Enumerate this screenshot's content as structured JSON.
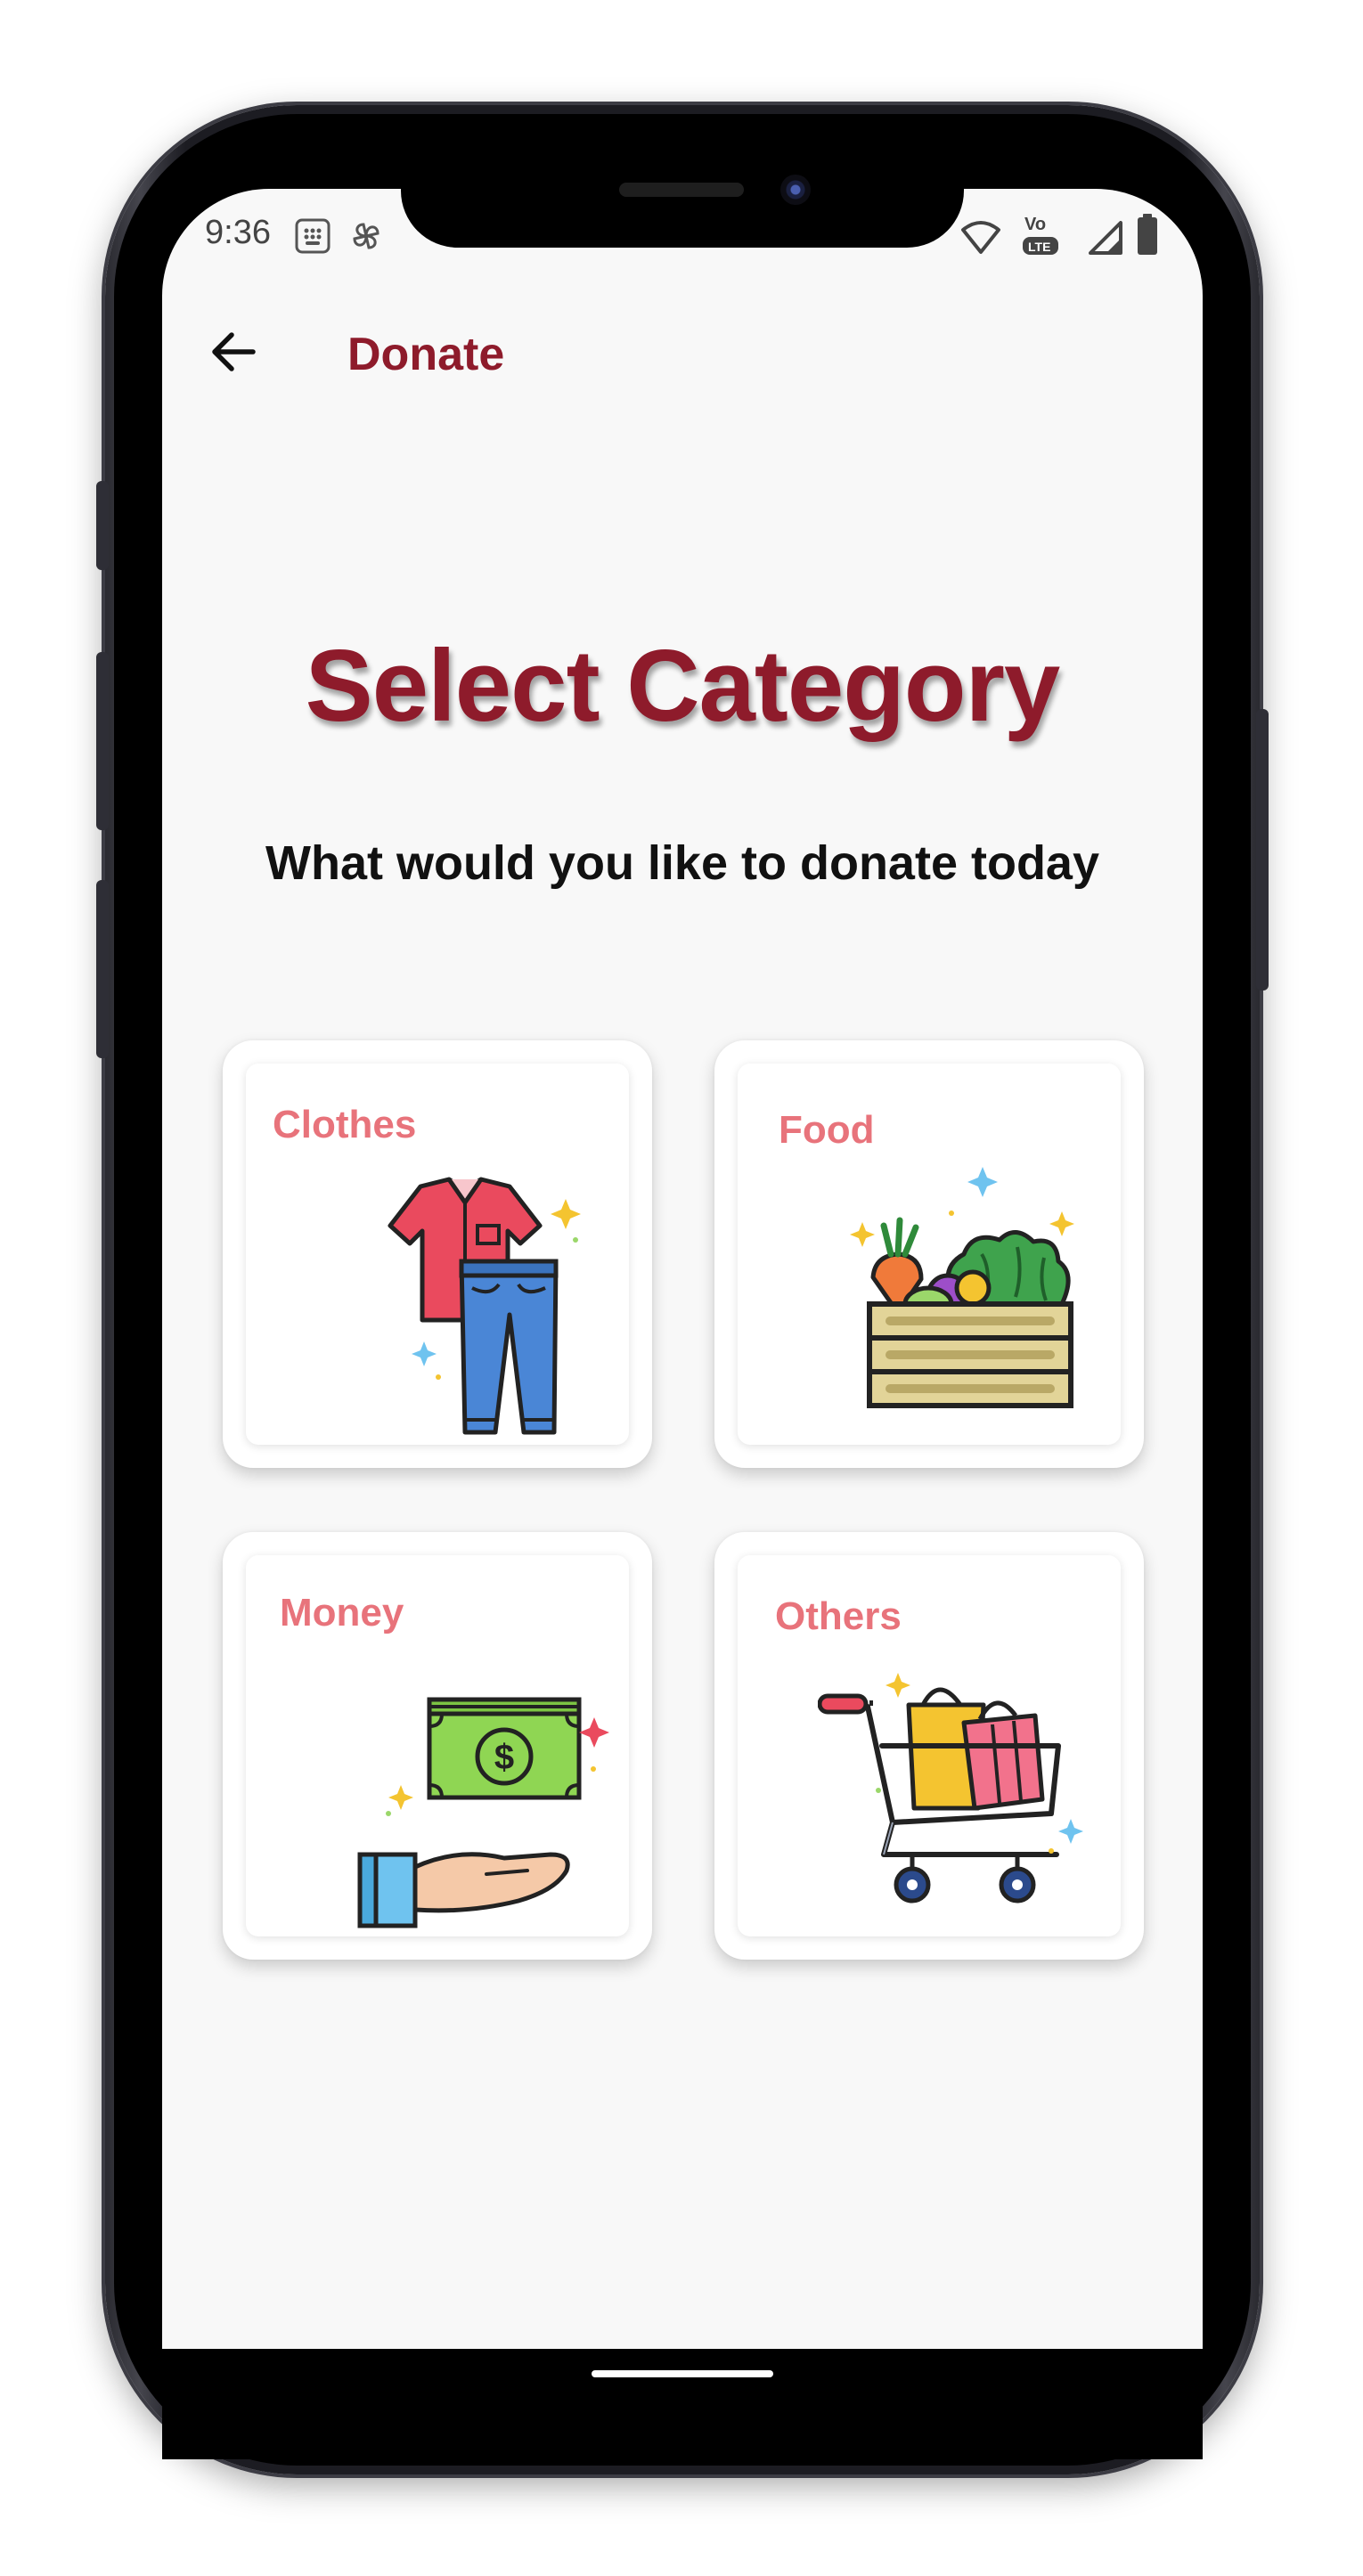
{
  "status_bar": {
    "time": "9:36"
  },
  "app_bar": {
    "title": "Donate",
    "back_icon": "arrow-left-icon"
  },
  "main": {
    "title": "Select Category",
    "subtitle": "What would you like to donate today"
  },
  "categories": [
    {
      "label": "Clothes",
      "icon": "clothes-icon"
    },
    {
      "label": "Food",
      "icon": "food-crate-icon"
    },
    {
      "label": "Money",
      "icon": "money-hand-icon"
    },
    {
      "label": "Others",
      "icon": "shopping-cart-icon"
    }
  ],
  "colors": {
    "brand": "#8e1b2b",
    "card_label": "#e8737b",
    "background": "#f8f8f8"
  }
}
